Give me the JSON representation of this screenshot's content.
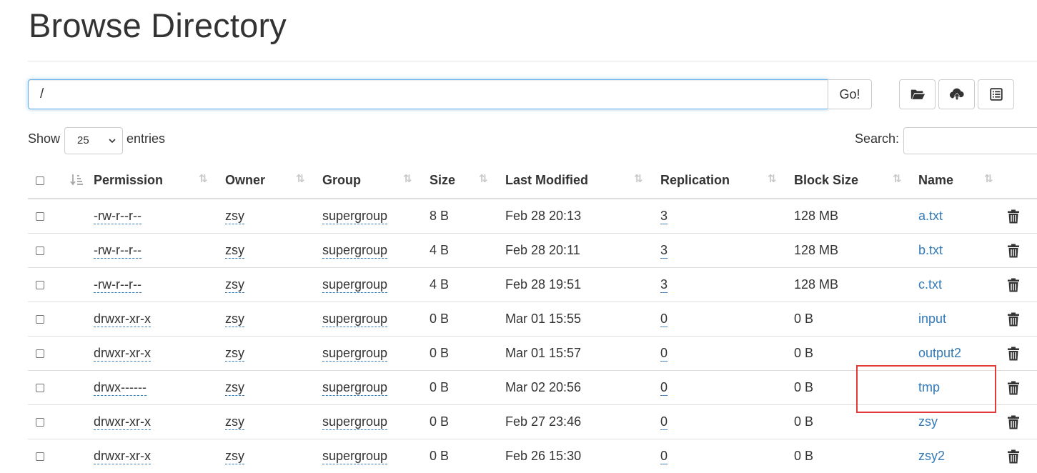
{
  "page": {
    "title": "Browse Directory"
  },
  "path_bar": {
    "value": "/",
    "go_label": "Go!"
  },
  "toolbar": {
    "icons": [
      "folder-open-icon",
      "cloud-upload-icon",
      "list-alt-icon"
    ]
  },
  "table_controls": {
    "show_label": "Show",
    "entries_value": "25",
    "entries_label": "entries",
    "search_label": "Search:"
  },
  "table": {
    "columns": [
      "Permission",
      "Owner",
      "Group",
      "Size",
      "Last Modified",
      "Replication",
      "Block Size",
      "Name"
    ],
    "rows": [
      {
        "permission": "-rw-r--r--",
        "owner": "zsy",
        "group": "supergroup",
        "size": "8 B",
        "modified": "Feb 28 20:13",
        "replication": "3",
        "block_size": "128 MB",
        "name": "a.txt"
      },
      {
        "permission": "-rw-r--r--",
        "owner": "zsy",
        "group": "supergroup",
        "size": "4 B",
        "modified": "Feb 28 20:11",
        "replication": "3",
        "block_size": "128 MB",
        "name": "b.txt"
      },
      {
        "permission": "-rw-r--r--",
        "owner": "zsy",
        "group": "supergroup",
        "size": "4 B",
        "modified": "Feb 28 19:51",
        "replication": "3",
        "block_size": "128 MB",
        "name": "c.txt"
      },
      {
        "permission": "drwxr-xr-x",
        "owner": "zsy",
        "group": "supergroup",
        "size": "0 B",
        "modified": "Mar 01 15:55",
        "replication": "0",
        "block_size": "0 B",
        "name": "input"
      },
      {
        "permission": "drwxr-xr-x",
        "owner": "zsy",
        "group": "supergroup",
        "size": "0 B",
        "modified": "Mar 01 15:57",
        "replication": "0",
        "block_size": "0 B",
        "name": "output2"
      },
      {
        "permission": "drwx------",
        "owner": "zsy",
        "group": "supergroup",
        "size": "0 B",
        "modified": "Mar 02 20:56",
        "replication": "0",
        "block_size": "0 B",
        "name": "tmp"
      },
      {
        "permission": "drwxr-xr-x",
        "owner": "zsy",
        "group": "supergroup",
        "size": "0 B",
        "modified": "Feb 27 23:46",
        "replication": "0",
        "block_size": "0 B",
        "name": "zsy"
      },
      {
        "permission": "drwxr-xr-x",
        "owner": "zsy",
        "group": "supergroup",
        "size": "0 B",
        "modified": "Feb 26 15:30",
        "replication": "0",
        "block_size": "0 B",
        "name": "zsy2"
      }
    ]
  },
  "annotation": {
    "highlighted_row": "tmp",
    "color": "#e03a3a"
  },
  "colors": {
    "link": "#337ab7",
    "focus_border": "#66afe9"
  }
}
